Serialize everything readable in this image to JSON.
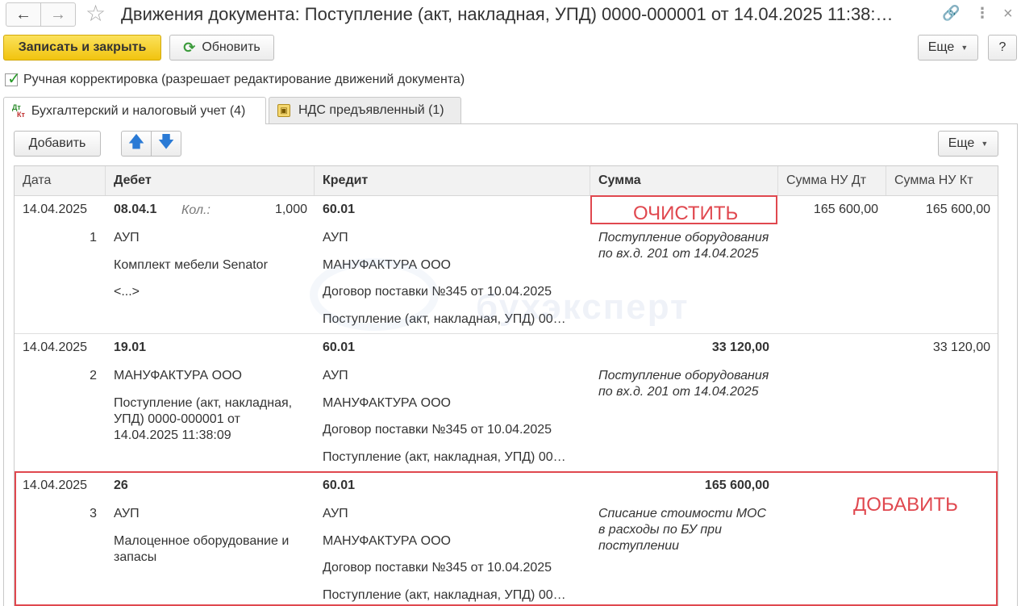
{
  "window": {
    "title": "Движения документа: Поступление (акт, накладная, УПД) 0000-000001 от 14.04.2025 11:38:…"
  },
  "toolbar": {
    "save_close_label": "Записать и закрыть",
    "refresh_label": "Обновить",
    "more_label": "Еще",
    "help_label": "?"
  },
  "manual_edit": {
    "label": "Ручная корректировка (разрешает редактирование движений документа)",
    "checked": true
  },
  "tabs": [
    {
      "label": "Бухгалтерский и налоговый учет (4)",
      "active": true
    },
    {
      "label": "НДС предъявленный (1)",
      "active": false
    }
  ],
  "tab_icon": {
    "dt": "Дт",
    "kt": "Кт"
  },
  "panel_toolbar": {
    "add_label": "Добавить",
    "more_label": "Еще"
  },
  "table": {
    "headers": [
      "Дата",
      "Дебет",
      "Кредит",
      "Сумма",
      "Сумма НУ Дт",
      "Сумма НУ Кт"
    ],
    "rows": [
      {
        "date": "14.04.2025",
        "num": "1",
        "debit_account": "08.04.1",
        "qty_label": "Кол.:",
        "qty_value": "1,000",
        "debit_sub": [
          "АУП",
          "Комплект мебели Senator",
          "<...>"
        ],
        "credit_account": "60.01",
        "credit_sub": [
          "АУП",
          "МАНУФАКТУРА ООО",
          "Договор поставки №345 от 10.04.2025",
          "Поступление (акт, накладная, УПД) 00…"
        ],
        "sum": "",
        "content": "Поступление оборудования по вх.д. 201 от 14.04.2025",
        "nu_dt": "165 600,00",
        "nu_kt": "165 600,00"
      },
      {
        "date": "14.04.2025",
        "num": "2",
        "debit_account": "19.01",
        "debit_sub": [
          "МАНУФАКТУРА ООО",
          "Поступление (акт, накладная, УПД) 0000-000001 от 14.04.2025 11:38:09"
        ],
        "credit_account": "60.01",
        "credit_sub": [
          "АУП",
          "МАНУФАКТУРА ООО",
          "Договор поставки №345 от 10.04.2025",
          "Поступление (акт, накладная, УПД) 00…"
        ],
        "sum": "33 120,00",
        "content": "Поступление оборудования по вх.д. 201 от 14.04.2025",
        "nu_dt": "",
        "nu_kt": "33 120,00"
      },
      {
        "date": "14.04.2025",
        "num": "3",
        "debit_account": "26",
        "debit_sub": [
          "АУП",
          "Малоценное оборудование и запасы"
        ],
        "credit_account": "60.01",
        "credit_sub": [
          "АУП",
          "МАНУФАКТУРА ООО",
          "Договор поставки №345 от 10.04.2025",
          "Поступление (акт, накладная, УПД) 00…"
        ],
        "sum": "165 600,00",
        "content": "Списание стоимости МОС в расходы по БУ при поступлении",
        "nu_dt": "",
        "nu_kt": ""
      }
    ]
  },
  "annotations": {
    "clear": "ОЧИСТИТЬ",
    "add": "ДОБАВИТЬ"
  },
  "watermark": "бухэксперт",
  "icons": {
    "back": "arrow-left-icon",
    "forward": "arrow-right-icon",
    "favorite": "star-icon",
    "link": "link-icon",
    "more": "more-vertical-icon",
    "close": "close-icon",
    "refresh": "refresh-icon",
    "up": "arrow-up-icon",
    "down": "arrow-down-icon"
  },
  "colors": {
    "primary_button": "#f1c40f",
    "annotation": "#e0484f",
    "check": "#2a9a2a",
    "arrows": "#2a7ad5"
  }
}
